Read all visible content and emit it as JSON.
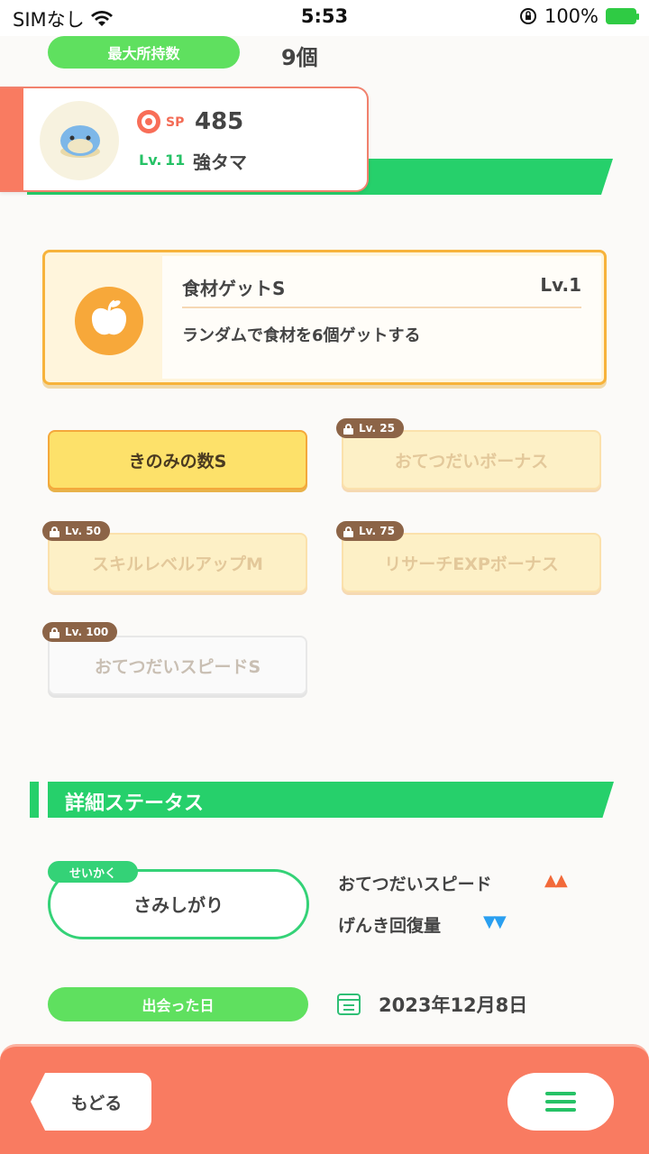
{
  "status_bar": {
    "carrier": "SIMなし",
    "time": "5:53",
    "battery": "100%"
  },
  "header": {
    "max_label": "最大所持数",
    "max_value": "9個"
  },
  "pokemon": {
    "sp_label": "SP",
    "sp_value": "485",
    "level_label": "Lv.",
    "level_value": "11",
    "name": "強タマ"
  },
  "main_skill": {
    "name": "食材ゲットS",
    "level": "Lv.1",
    "description": "ランダムで食材を6個ゲットする"
  },
  "sub_skills": [
    {
      "label": "きのみの数S",
      "lock": "",
      "state": "active"
    },
    {
      "label": "おてつだいボーナス",
      "lock": "Lv. 25",
      "state": "locked"
    },
    {
      "label": "スキルレベルアップM",
      "lock": "Lv. 50",
      "state": "locked"
    },
    {
      "label": "リサーチEXPボーナス",
      "lock": "Lv. 75",
      "state": "locked"
    },
    {
      "label": "おてつだいスピードS",
      "lock": "Lv. 100",
      "state": "locked"
    }
  ],
  "details": {
    "title": "詳細ステータス",
    "nature_tag": "せいかく",
    "nature_value": "さみしがり",
    "up_effect": "おてつだいスピード",
    "up_arrows": "▲▲",
    "down_effect": "げんき回復量",
    "down_arrows": "▼▼",
    "met_label": "出会った日",
    "met_date": "2023年12月8日"
  },
  "footer": {
    "back_label": "もどる"
  },
  "colors": {
    "green": "#26d06b",
    "orange": "#f97b61",
    "yellow": "#fde16a",
    "gold_border": "#f7b33b"
  }
}
